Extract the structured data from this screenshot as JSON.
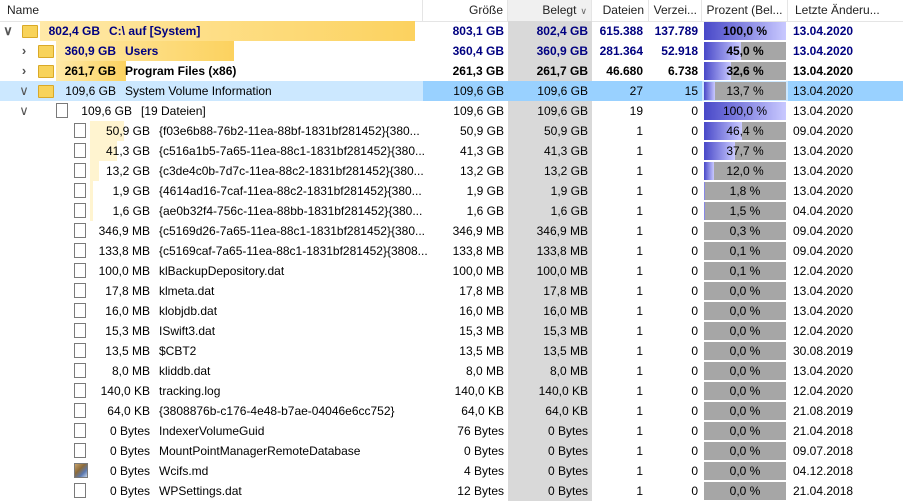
{
  "header": {
    "name": "Name",
    "size": "Größe",
    "belegt": "Belegt",
    "files": "Dateien",
    "dirs": "Verzei...",
    "percent": "Prozent (Bel...",
    "date": "Letzte Änderu..."
  },
  "rows": [
    {
      "toggle": "v",
      "icon": "folder",
      "size_label": "802,4 GB",
      "name": "C:\\  auf  [System]",
      "size": "803,1 GB",
      "belegt": "802,4 GB",
      "files": "615.388",
      "dirs": "137.789",
      "percent": "100,0 %",
      "percent_value": 100.0,
      "date": "13.04.2020",
      "bold": true,
      "blue": true,
      "indent": 0,
      "bar": 1.0
    },
    {
      "toggle": ">",
      "icon": "folder",
      "size_label": "360,9 GB",
      "name": "Users",
      "size": "360,4 GB",
      "belegt": "360,9 GB",
      "files": "281.364",
      "dirs": "52.918",
      "percent": "45,0 %",
      "percent_value": 45.0,
      "date": "13.04.2020",
      "bold": true,
      "blue": true,
      "indent": 1,
      "bar": 0.45
    },
    {
      "toggle": ">",
      "icon": "folder",
      "size_label": "261,7 GB",
      "name": "Program Files (x86)",
      "size": "261,3 GB",
      "belegt": "261,7 GB",
      "files": "46.680",
      "dirs": "6.738",
      "percent": "32,6 %",
      "percent_value": 32.6,
      "date": "13.04.2020",
      "bold": true,
      "blue": false,
      "indent": 1,
      "bar": 0.326
    },
    {
      "toggle": "v",
      "icon": "folder",
      "size_label": "109,6 GB",
      "name": "System Volume Information",
      "size": "109,6 GB",
      "belegt": "109,6 GB",
      "files": "27",
      "dirs": "15",
      "percent": "13,7 %",
      "percent_value": 13.7,
      "date": "13.04.2020",
      "bold": false,
      "blue": false,
      "indent": 1,
      "bar": 0.137,
      "selected": true
    },
    {
      "toggle": "v",
      "icon": "file",
      "size_label": "109,6 GB",
      "name": "[19 Dateien]",
      "size": "109,6 GB",
      "belegt": "109,6 GB",
      "files": "19",
      "dirs": "0",
      "percent": "100,0 %",
      "percent_value": 100.0,
      "date": "13.04.2020",
      "bold": false,
      "blue": false,
      "indent": 2,
      "bar": 0.4
    },
    {
      "toggle": "",
      "icon": "file",
      "size_label": "50,9 GB",
      "name": "{f03e6b88-76b2-11ea-88bf-1831bf281452}{380...",
      "size": "50,9 GB",
      "belegt": "50,9 GB",
      "files": "1",
      "dirs": "0",
      "percent": "46,4 %",
      "percent_value": 46.4,
      "date": "09.04.2020",
      "indent": 3,
      "bar": 0.464
    },
    {
      "toggle": "",
      "icon": "file",
      "size_label": "41,3 GB",
      "name": "{c516a1b5-7a65-11ea-88c1-1831bf281452}{380...",
      "size": "41,3 GB",
      "belegt": "41,3 GB",
      "files": "1",
      "dirs": "0",
      "percent": "37,7 %",
      "percent_value": 37.7,
      "date": "13.04.2020",
      "indent": 3,
      "bar": 0.377
    },
    {
      "toggle": "",
      "icon": "file",
      "size_label": "13,2 GB",
      "name": "{c3de4c0b-7d7c-11ea-88c2-1831bf281452}{380...",
      "size": "13,2 GB",
      "belegt": "13,2 GB",
      "files": "1",
      "dirs": "0",
      "percent": "12,0 %",
      "percent_value": 12.0,
      "date": "13.04.2020",
      "indent": 3,
      "bar": 0.12
    },
    {
      "toggle": "",
      "icon": "file",
      "size_label": "1,9 GB",
      "name": "{4614ad16-7caf-11ea-88c2-1831bf281452}{380...",
      "size": "1,9 GB",
      "belegt": "1,9 GB",
      "files": "1",
      "dirs": "0",
      "percent": "1,8 %",
      "percent_value": 1.8,
      "date": "13.04.2020",
      "indent": 3,
      "bar": 0.04
    },
    {
      "toggle": "",
      "icon": "file",
      "size_label": "1,6 GB",
      "name": "{ae0b32f4-756c-11ea-88bb-1831bf281452}{380...",
      "size": "1,6 GB",
      "belegt": "1,6 GB",
      "files": "1",
      "dirs": "0",
      "percent": "1,5 %",
      "percent_value": 1.5,
      "date": "04.04.2020",
      "indent": 3,
      "bar": 0.03
    },
    {
      "toggle": "",
      "icon": "file",
      "size_label": "346,9 MB",
      "name": "{c5169d26-7a65-11ea-88c1-1831bf281452}{380...",
      "size": "346,9 MB",
      "belegt": "346,9 MB",
      "files": "1",
      "dirs": "0",
      "percent": "0,3 %",
      "percent_value": 0.3,
      "date": "09.04.2020",
      "indent": 3,
      "bar": 0
    },
    {
      "toggle": "",
      "icon": "file",
      "size_label": "133,8 MB",
      "name": "{c5169caf-7a65-11ea-88c1-1831bf281452}{3808...",
      "size": "133,8 MB",
      "belegt": "133,8 MB",
      "files": "1",
      "dirs": "0",
      "percent": "0,1 %",
      "percent_value": 0.1,
      "date": "09.04.2020",
      "indent": 3,
      "bar": 0
    },
    {
      "toggle": "",
      "icon": "file",
      "size_label": "100,0 MB",
      "name": "klBackupDepository.dat",
      "size": "100,0 MB",
      "belegt": "100,0 MB",
      "files": "1",
      "dirs": "0",
      "percent": "0,1 %",
      "percent_value": 0.1,
      "date": "12.04.2020",
      "indent": 3,
      "bar": 0
    },
    {
      "toggle": "",
      "icon": "file",
      "size_label": "17,8 MB",
      "name": "klmeta.dat",
      "size": "17,8 MB",
      "belegt": "17,8 MB",
      "files": "1",
      "dirs": "0",
      "percent": "0,0 %",
      "percent_value": 0.0,
      "date": "13.04.2020",
      "indent": 3,
      "bar": 0
    },
    {
      "toggle": "",
      "icon": "file",
      "size_label": "16,0 MB",
      "name": "klobjdb.dat",
      "size": "16,0 MB",
      "belegt": "16,0 MB",
      "files": "1",
      "dirs": "0",
      "percent": "0,0 %",
      "percent_value": 0.0,
      "date": "13.04.2020",
      "indent": 3,
      "bar": 0
    },
    {
      "toggle": "",
      "icon": "file",
      "size_label": "15,3 MB",
      "name": "ISwift3.dat",
      "size": "15,3 MB",
      "belegt": "15,3 MB",
      "files": "1",
      "dirs": "0",
      "percent": "0,0 %",
      "percent_value": 0.0,
      "date": "12.04.2020",
      "indent": 3,
      "bar": 0
    },
    {
      "toggle": "",
      "icon": "file",
      "size_label": "13,5 MB",
      "name": "$CBT2",
      "size": "13,5 MB",
      "belegt": "13,5 MB",
      "files": "1",
      "dirs": "0",
      "percent": "0,0 %",
      "percent_value": 0.0,
      "date": "30.08.2019",
      "indent": 3,
      "bar": 0
    },
    {
      "toggle": "",
      "icon": "file",
      "size_label": "8,0 MB",
      "name": "kliddb.dat",
      "size": "8,0 MB",
      "belegt": "8,0 MB",
      "files": "1",
      "dirs": "0",
      "percent": "0,0 %",
      "percent_value": 0.0,
      "date": "13.04.2020",
      "indent": 3,
      "bar": 0
    },
    {
      "toggle": "",
      "icon": "file",
      "size_label": "140,0 KB",
      "name": "tracking.log",
      "size": "140,0 KB",
      "belegt": "140,0 KB",
      "files": "1",
      "dirs": "0",
      "percent": "0,0 %",
      "percent_value": 0.0,
      "date": "12.04.2020",
      "indent": 3,
      "bar": 0
    },
    {
      "toggle": "",
      "icon": "file",
      "size_label": "64,0 KB",
      "name": "{3808876b-c176-4e48-b7ae-04046e6cc752}",
      "size": "64,0 KB",
      "belegt": "64,0 KB",
      "files": "1",
      "dirs": "0",
      "percent": "0,0 %",
      "percent_value": 0.0,
      "date": "21.08.2019",
      "indent": 3,
      "bar": 0
    },
    {
      "toggle": "",
      "icon": "file",
      "size_label": "0 Bytes",
      "name": "IndexerVolumeGuid",
      "size": "76 Bytes",
      "belegt": "0 Bytes",
      "files": "1",
      "dirs": "0",
      "percent": "0,0 %",
      "percent_value": 0.0,
      "date": "21.04.2018",
      "indent": 3,
      "bar": 0
    },
    {
      "toggle": "",
      "icon": "file",
      "size_label": "0 Bytes",
      "name": "MountPointManagerRemoteDatabase",
      "size": "0 Bytes",
      "belegt": "0 Bytes",
      "files": "1",
      "dirs": "0",
      "percent": "0,0 %",
      "percent_value": 0.0,
      "date": "09.07.2018",
      "indent": 3,
      "bar": 0
    },
    {
      "toggle": "",
      "icon": "media",
      "size_label": "0 Bytes",
      "name": "Wcifs.md",
      "size": "4 Bytes",
      "belegt": "0 Bytes",
      "files": "1",
      "dirs": "0",
      "percent": "0,0 %",
      "percent_value": 0.0,
      "date": "04.12.2018",
      "indent": 3,
      "bar": 0
    },
    {
      "toggle": "",
      "icon": "file",
      "size_label": "0 Bytes",
      "name": "WPSettings.dat",
      "size": "12 Bytes",
      "belegt": "0 Bytes",
      "files": "1",
      "dirs": "0",
      "percent": "0,0 %",
      "percent_value": 0.0,
      "date": "21.04.2018",
      "indent": 3,
      "bar": 0
    }
  ]
}
